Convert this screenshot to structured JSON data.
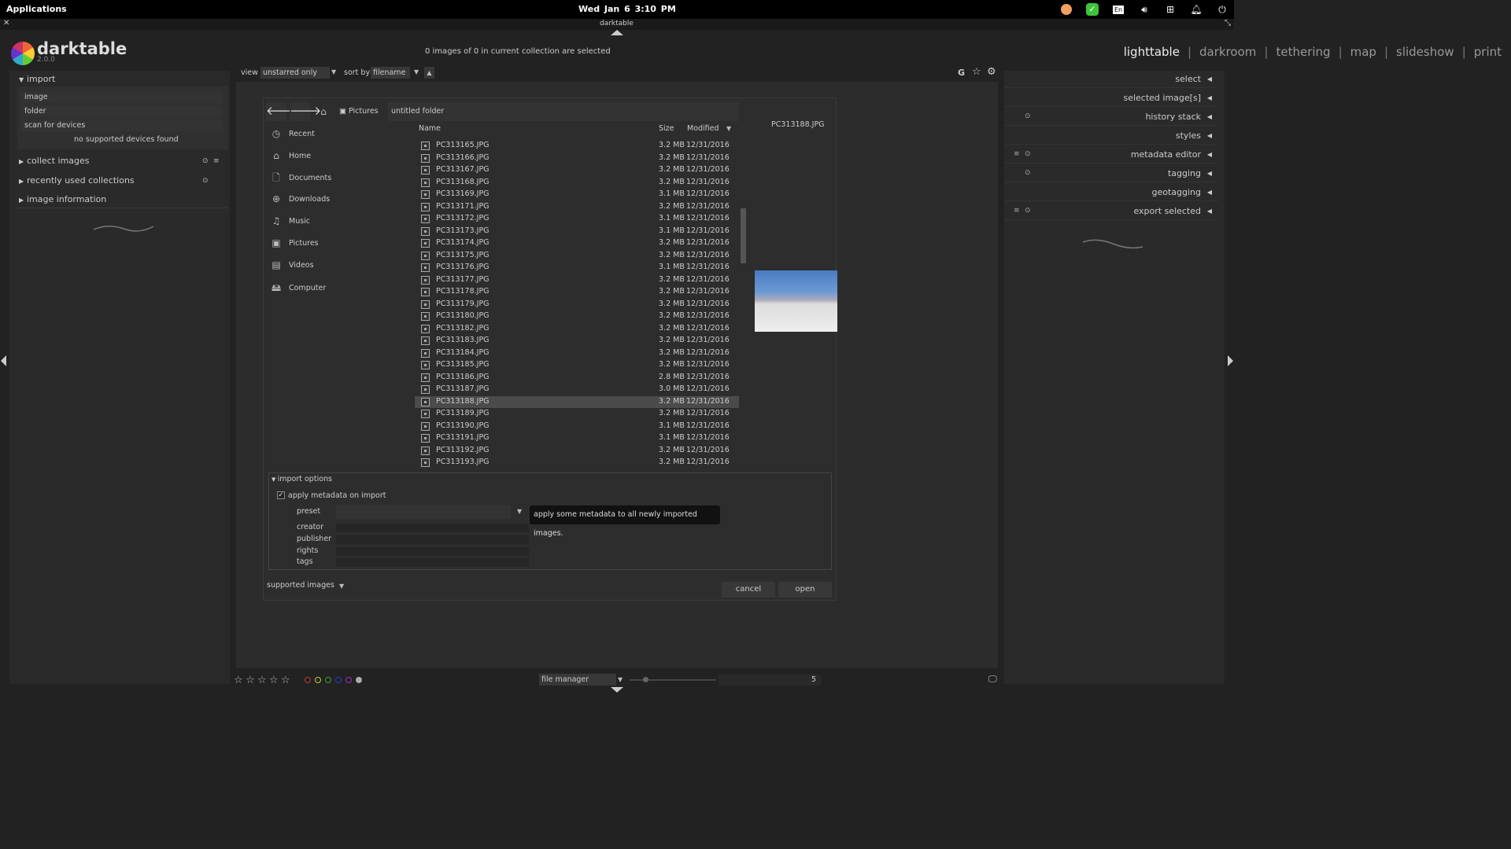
{
  "topbar": {
    "applications": "Applications",
    "clock": "Wed Jan  6    3:10 PM",
    "tray": {
      "en_label": "En"
    }
  },
  "window": {
    "title": "darktable"
  },
  "app": {
    "name": "darktable",
    "version": "2.0.0"
  },
  "header": {
    "selected_text": "0 images of 0 in current collection are selected"
  },
  "views": [
    "lighttable",
    "darkroom",
    "tethering",
    "map",
    "slideshow",
    "print"
  ],
  "views_sep": "|",
  "filter": {
    "view_label": "view",
    "view_value": "unstarred only",
    "sort_label": "sort by",
    "sort_value": "filename"
  },
  "toolbar_right": {
    "g_label": "G"
  },
  "left_panel": {
    "import_title": "import",
    "buttons": [
      "image",
      "folder",
      "scan for devices"
    ],
    "no_devices": "no supported devices found",
    "sections": [
      "collect images",
      "recently used collections",
      "image information"
    ]
  },
  "right_panel": {
    "items": [
      "select",
      "selected image[s]",
      "history stack",
      "styles",
      "metadata editor",
      "tagging",
      "geotagging",
      "export selected"
    ]
  },
  "dialog": {
    "path": [
      "Pictures",
      "untitled folder"
    ],
    "places": [
      "Recent",
      "Home",
      "Documents",
      "Downloads",
      "Music",
      "Pictures",
      "Videos",
      "Computer"
    ],
    "columns": {
      "name": "Name",
      "size": "Size",
      "modified": "Modified"
    },
    "preview_filename": "PC313188.JPG",
    "files": [
      {
        "name": "PC313165.JPG",
        "size": "3.2 MB",
        "date": "12/31/2016"
      },
      {
        "name": "PC313166.JPG",
        "size": "3.2 MB",
        "date": "12/31/2016"
      },
      {
        "name": "PC313167.JPG",
        "size": "3.2 MB",
        "date": "12/31/2016"
      },
      {
        "name": "PC313168.JPG",
        "size": "3.2 MB",
        "date": "12/31/2016"
      },
      {
        "name": "PC313169.JPG",
        "size": "3.1 MB",
        "date": "12/31/2016"
      },
      {
        "name": "PC313171.JPG",
        "size": "3.2 MB",
        "date": "12/31/2016"
      },
      {
        "name": "PC313172.JPG",
        "size": "3.1 MB",
        "date": "12/31/2016"
      },
      {
        "name": "PC313173.JPG",
        "size": "3.1 MB",
        "date": "12/31/2016"
      },
      {
        "name": "PC313174.JPG",
        "size": "3.2 MB",
        "date": "12/31/2016"
      },
      {
        "name": "PC313175.JPG",
        "size": "3.2 MB",
        "date": "12/31/2016"
      },
      {
        "name": "PC313176.JPG",
        "size": "3.1 MB",
        "date": "12/31/2016"
      },
      {
        "name": "PC313177.JPG",
        "size": "3.2 MB",
        "date": "12/31/2016"
      },
      {
        "name": "PC313178.JPG",
        "size": "3.2 MB",
        "date": "12/31/2016"
      },
      {
        "name": "PC313179.JPG",
        "size": "3.2 MB",
        "date": "12/31/2016"
      },
      {
        "name": "PC313180.JPG",
        "size": "3.2 MB",
        "date": "12/31/2016"
      },
      {
        "name": "PC313182.JPG",
        "size": "3.2 MB",
        "date": "12/31/2016"
      },
      {
        "name": "PC313183.JPG",
        "size": "3.2 MB",
        "date": "12/31/2016"
      },
      {
        "name": "PC313184.JPG",
        "size": "3.2 MB",
        "date": "12/31/2016"
      },
      {
        "name": "PC313185.JPG",
        "size": "3.2 MB",
        "date": "12/31/2016"
      },
      {
        "name": "PC313186.JPG",
        "size": "2.8 MB",
        "date": "12/31/2016"
      },
      {
        "name": "PC313187.JPG",
        "size": "3.0 MB",
        "date": "12/31/2016"
      },
      {
        "name": "PC313188.JPG",
        "size": "3.2 MB",
        "date": "12/31/2016",
        "selected": true
      },
      {
        "name": "PC313189.JPG",
        "size": "3.2 MB",
        "date": "12/31/2016"
      },
      {
        "name": "PC313190.JPG",
        "size": "3.1 MB",
        "date": "12/31/2016"
      },
      {
        "name": "PC313191.JPG",
        "size": "3.1 MB",
        "date": "12/31/2016"
      },
      {
        "name": "PC313192.JPG",
        "size": "3.2 MB",
        "date": "12/31/2016"
      },
      {
        "name": "PC313193.JPG",
        "size": "3.2 MB",
        "date": "12/31/2016"
      }
    ],
    "import_options": {
      "title": "import options",
      "apply_metadata": "apply metadata on import",
      "fields": [
        "preset",
        "creator",
        "publisher",
        "rights",
        "tags"
      ],
      "tooltip": "apply some metadata to all newly imported images."
    },
    "filter_value": "supported images",
    "cancel": "cancel",
    "open": "open"
  },
  "bottom": {
    "stars": [
      "☆",
      "☆",
      "☆",
      "☆",
      "☆"
    ],
    "color_labels": [
      "#c0392b",
      "#c8c832",
      "#3aa03a",
      "#2a3ad0",
      "#a030c0",
      "#aaaaaa"
    ],
    "layout_value": "file manager",
    "zoom_value": "5"
  }
}
